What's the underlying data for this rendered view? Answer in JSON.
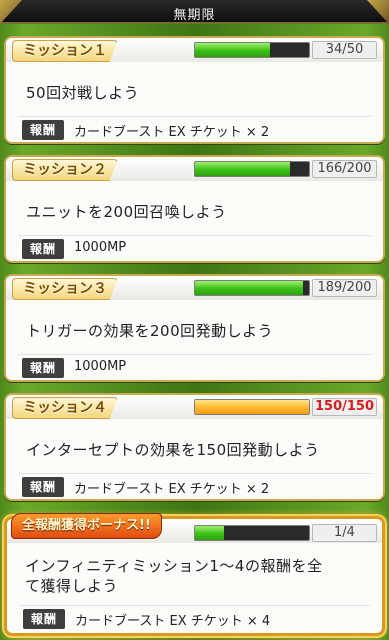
{
  "header": {
    "title": "無期限"
  },
  "reward_label": "報酬",
  "missions": [
    {
      "title": "ミッション１",
      "progress_fraction": 0.66,
      "count": "34/50",
      "description": "50回対戦しよう",
      "reward": "カードブースト EX チケット × 2",
      "complete": false
    },
    {
      "title": "ミッション２",
      "progress_fraction": 0.83,
      "count": "166/200",
      "description": "ユニットを200回召喚しよう",
      "reward": "1000MP",
      "complete": false
    },
    {
      "title": "ミッション３",
      "progress_fraction": 0.945,
      "count": "189/200",
      "description": "トリガーの効果を200回発動しよう",
      "reward": "1000MP",
      "complete": false
    },
    {
      "title": "ミッション４",
      "progress_fraction": 1.0,
      "count": "150/150",
      "description": "インターセプトの効果を150回発動しよう",
      "reward": "カードブースト EX チケット × 2",
      "complete": true
    }
  ],
  "bonus": {
    "title": "全報酬獲得ボーナス!!",
    "progress_fraction": 0.25,
    "count": "1/4",
    "description_line1": "インフィニティミッション1〜4の報酬を全",
    "description_line2": "て獲得しよう",
    "reward": "カードブースト EX チケット × 4"
  },
  "colors": {
    "progress_green": "#3bbf18",
    "progress_complete_orange": "#ffb72e",
    "complete_count_red": "#d81c1c",
    "card_border_gold": "#c9a94f"
  }
}
